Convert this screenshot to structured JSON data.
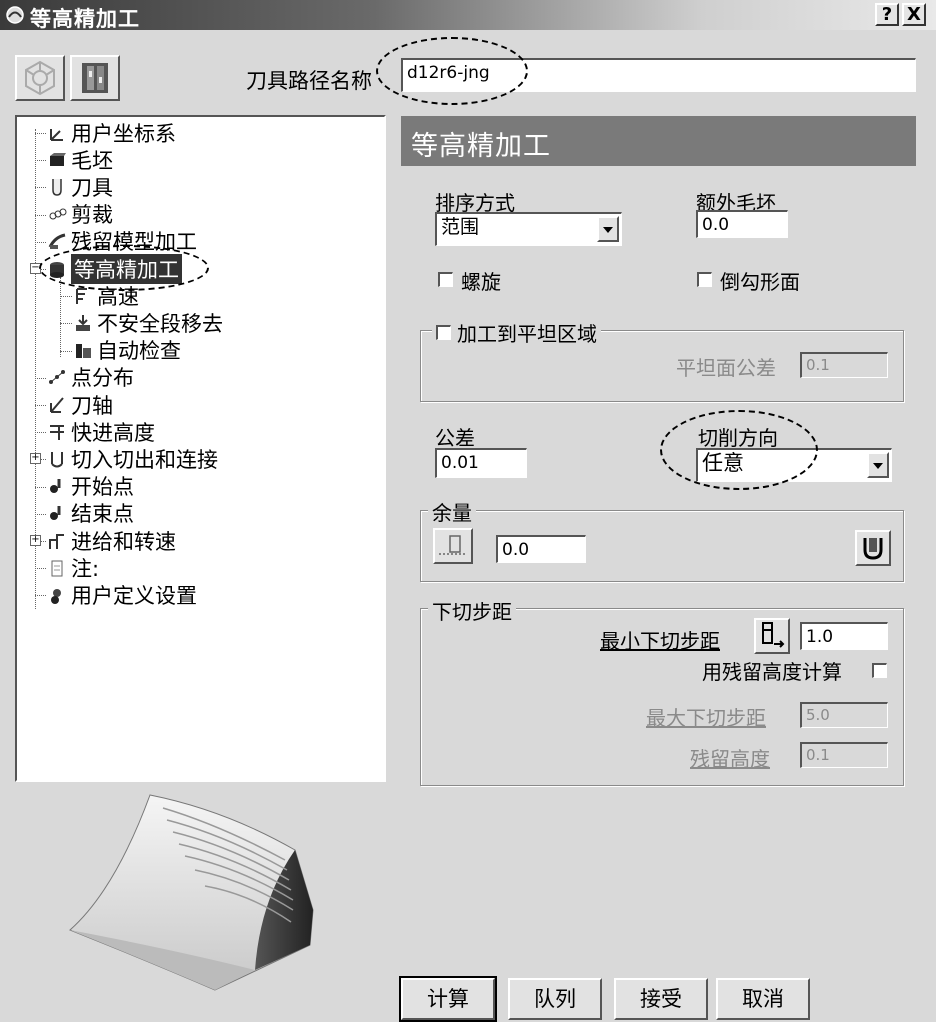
{
  "window": {
    "title": "等高精加工",
    "help_label": "?",
    "close_label": "X"
  },
  "toolbar": {
    "path_name_label": "刀具路径名称",
    "path_name_value": "d12r6-jng"
  },
  "tree": {
    "items": [
      {
        "label": "用户坐标系",
        "icon": "ucs-icon"
      },
      {
        "label": "毛坯",
        "icon": "stock-icon"
      },
      {
        "label": "刀具",
        "icon": "tool-icon"
      },
      {
        "label": "剪裁",
        "icon": "trim-icon"
      },
      {
        "label": "残留模型加工",
        "icon": "rest-model-icon"
      },
      {
        "label": "等高精加工",
        "icon": "constant-z-icon",
        "selected": true,
        "expander": "−"
      },
      {
        "label": "高速",
        "icon": "high-speed-icon",
        "child": true
      },
      {
        "label": "不安全段移去",
        "icon": "unsafe-segment-icon",
        "child": true
      },
      {
        "label": "自动检查",
        "icon": "auto-check-icon",
        "child": true
      },
      {
        "label": "点分布",
        "icon": "point-distribution-icon"
      },
      {
        "label": "刀轴",
        "icon": "tool-axis-icon"
      },
      {
        "label": "快进高度",
        "icon": "rapid-height-icon"
      },
      {
        "label": "切入切出和连接",
        "icon": "leads-links-icon",
        "expander": "+"
      },
      {
        "label": "开始点",
        "icon": "start-point-icon"
      },
      {
        "label": "结束点",
        "icon": "end-point-icon"
      },
      {
        "label": "进给和转速",
        "icon": "feeds-speeds-icon",
        "expander": "+"
      },
      {
        "label": "注:",
        "icon": "notes-icon"
      },
      {
        "label": "用户定义设置",
        "icon": "user-defined-icon"
      }
    ]
  },
  "panel": {
    "header": "等高精加工",
    "ordering_label": "排序方式",
    "ordering_value": "范围",
    "extra_stock_label": "额外毛坯",
    "extra_stock_value": "0.0",
    "spiral_label": "螺旋",
    "undercut_label": "倒勾形面",
    "flat_group_label": "加工到平坦区域",
    "flat_tolerance_label": "平坦面公差",
    "flat_tolerance_value": "0.1",
    "tolerance_label": "公差",
    "tolerance_value": "0.01",
    "cut_direction_label": "切削方向",
    "cut_direction_value": "任意",
    "allowance_group_label": "余量",
    "allowance_value": "0.0",
    "stepdown_group_label": "下切步距",
    "min_stepdown_label": "最小下切步距",
    "min_stepdown_value": "1.0",
    "use_cusp_label": "用残留高度计算",
    "max_stepdown_label": "最大下切步距",
    "max_stepdown_value": "5.0",
    "cusp_height_label": "残留高度",
    "cusp_height_value": "0.1"
  },
  "buttons": {
    "calculate": "计算",
    "queue": "队列",
    "accept": "接受",
    "cancel": "取消"
  }
}
